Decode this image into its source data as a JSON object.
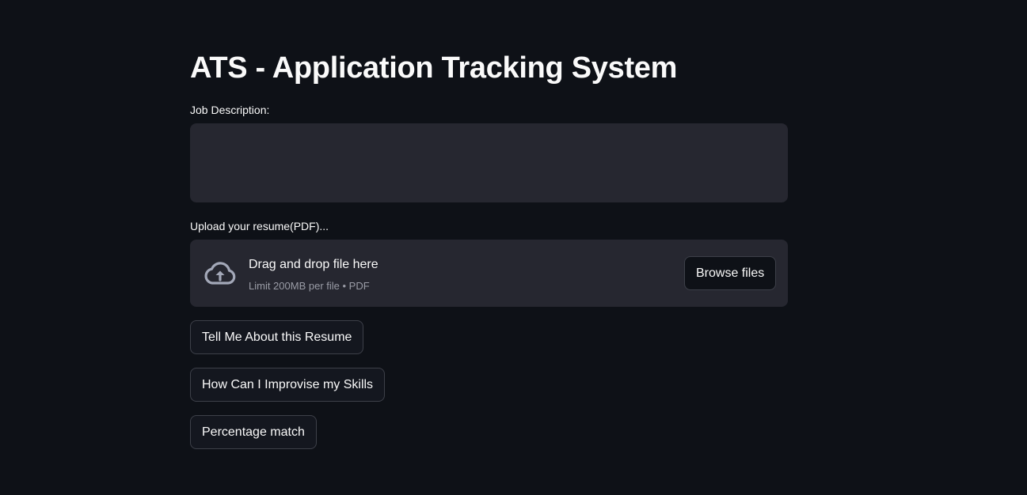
{
  "page": {
    "title": "ATS - Application Tracking System"
  },
  "job_description": {
    "label": "Job Description:",
    "value": ""
  },
  "uploader": {
    "label": "Upload your resume(PDF)...",
    "drop_text": "Drag and drop file here",
    "limit_text": "Limit 200MB per file • PDF",
    "browse_label": "Browse files",
    "icon": "cloud-upload-icon"
  },
  "actions": {
    "about_label": "Tell Me About this Resume",
    "improve_label": "How Can I Improvise my Skills",
    "percent_label": "Percentage match"
  },
  "colors": {
    "background": "#0e1117",
    "surface": "#262730",
    "text": "#fafafa",
    "muted_text": "#9a9ca6",
    "button_border": "#3d4049"
  }
}
